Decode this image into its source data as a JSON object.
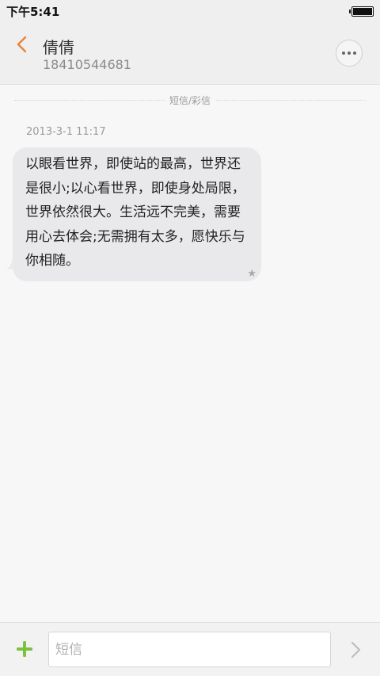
{
  "status_bar": {
    "time": "下午5:41",
    "battery_icon": "battery-full-icon"
  },
  "header": {
    "back_icon": "chevron-left-icon",
    "contact_name": "倩倩",
    "contact_number": "18410544681",
    "more_icon": "more-horizontal-icon"
  },
  "thread": {
    "divider_label": "短信/彩信",
    "messages": [
      {
        "timestamp": "2013-3-1 11:17",
        "text": "以眼看世界，即使站的最高，世界还是很小;以心看世界，即使身处局限，世界依然很大。生活远不完美，需要用心去体会;无需拥有太多，愿快乐与你相随。",
        "starred": true,
        "star_glyph": "★"
      }
    ]
  },
  "composer": {
    "add_icon": "plus-icon",
    "input_placeholder": "短信",
    "input_value": "",
    "send_icon": "chevron-right-icon"
  },
  "colors": {
    "accent_orange": "#e8843a",
    "add_green": "#7cc240",
    "bubble_bg": "#e9e9ec",
    "header_bg": "#efefef",
    "page_bg": "#f7f7f7",
    "send_gray": "#bdbdbd"
  }
}
